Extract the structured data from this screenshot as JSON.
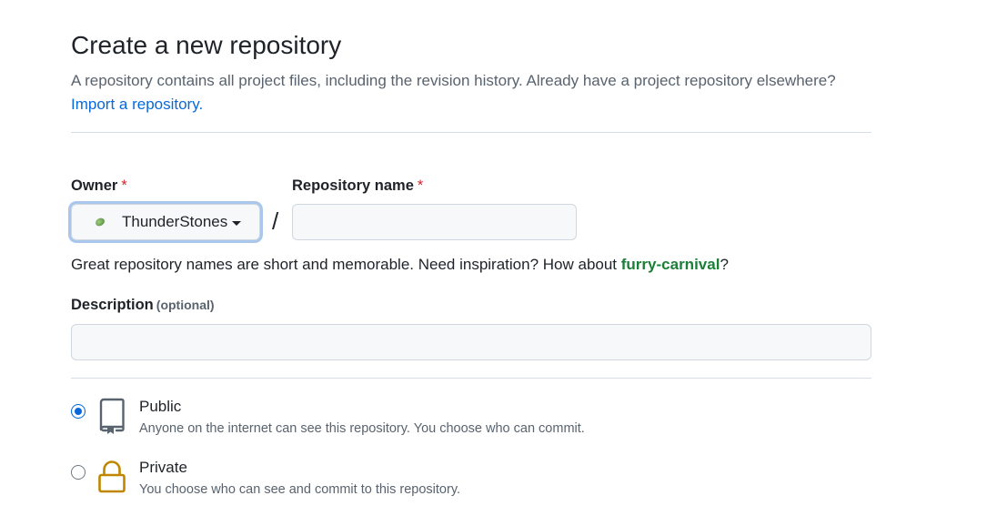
{
  "header": {
    "title": "Create a new repository",
    "description": "A repository contains all project files, including the revision history. Already have a project repository elsewhere?",
    "import_link": "Import a repository."
  },
  "owner": {
    "label": "Owner",
    "required_mark": "*",
    "selected": "ThunderStones",
    "avatar_icon": "green-avatar-icon"
  },
  "repository": {
    "label": "Repository name",
    "required_mark": "*",
    "separator": "/",
    "value": "",
    "placeholder": ""
  },
  "hint": {
    "prefix": "Great repository names are short and memorable. Need inspiration? How about ",
    "suggestion": "furry-carnival",
    "suffix": "?"
  },
  "description_field": {
    "label": "Description",
    "optional": "(optional)",
    "value": "",
    "placeholder": ""
  },
  "visibility": {
    "options": [
      {
        "label": "Public",
        "description": "Anyone on the internet can see this repository. You choose who can commit.",
        "selected": true,
        "icon": "repo-book-icon"
      },
      {
        "label": "Private",
        "description": "You choose who can see and commit to this repository.",
        "selected": false,
        "icon": "lock-icon"
      }
    ]
  },
  "colors": {
    "link": "#0969da",
    "suggestion": "#1a7f37",
    "required": "#d1242f",
    "lock_icon": "#bf8700",
    "focus_ring": "#a9c7ec"
  }
}
